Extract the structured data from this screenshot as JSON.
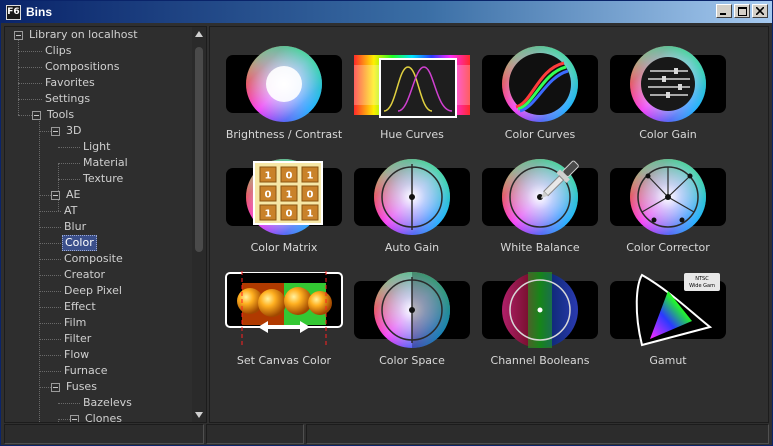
{
  "window": {
    "title": "Bins",
    "app_badge": "F6"
  },
  "tree": {
    "items": [
      {
        "label": "Library on localhost",
        "level": 0,
        "expander": true
      },
      {
        "label": "Clips",
        "level": 1
      },
      {
        "label": "Compositions",
        "level": 1
      },
      {
        "label": "Favorites",
        "level": 1
      },
      {
        "label": "Settings",
        "level": 1
      },
      {
        "label": "Tools",
        "level": 1,
        "expander": true
      },
      {
        "label": "3D",
        "level": 2,
        "expander": true
      },
      {
        "label": "Light",
        "level": 3
      },
      {
        "label": "Material",
        "level": 3
      },
      {
        "label": "Texture",
        "level": 3
      },
      {
        "label": "AE",
        "level": 2,
        "expander": true
      },
      {
        "label": "AT",
        "level": 2
      },
      {
        "label": "Blur",
        "level": 2
      },
      {
        "label": "Color",
        "level": 2,
        "selected": true
      },
      {
        "label": "Composite",
        "level": 2
      },
      {
        "label": "Creator",
        "level": 2
      },
      {
        "label": "Deep Pixel",
        "level": 2
      },
      {
        "label": "Effect",
        "level": 2
      },
      {
        "label": "Film",
        "level": 2
      },
      {
        "label": "Filter",
        "level": 2
      },
      {
        "label": "Flow",
        "level": 2
      },
      {
        "label": "Furnace",
        "level": 2
      },
      {
        "label": "Fuses",
        "level": 2,
        "expander": true
      },
      {
        "label": "Bazelevs",
        "level": 3
      },
      {
        "label": "Clones",
        "level": 3,
        "expander": true
      }
    ]
  },
  "tools": [
    {
      "label": "Brightness / Contrast",
      "icon": "brightness-contrast-icon"
    },
    {
      "label": "Hue Curves",
      "icon": "hue-curves-icon"
    },
    {
      "label": "Color Curves",
      "icon": "color-curves-icon"
    },
    {
      "label": "Color Gain",
      "icon": "color-gain-icon"
    },
    {
      "label": "Color Matrix",
      "icon": "color-matrix-icon",
      "matrix": [
        "1",
        "0",
        "1",
        "0",
        "1",
        "0",
        "1",
        "0",
        "1"
      ]
    },
    {
      "label": "Auto Gain",
      "icon": "auto-gain-icon"
    },
    {
      "label": "White Balance",
      "icon": "white-balance-icon"
    },
    {
      "label": "Color Corrector",
      "icon": "color-corrector-icon"
    },
    {
      "label": "Set Canvas Color",
      "icon": "set-canvas-color-icon"
    },
    {
      "label": "Color Space",
      "icon": "color-space-icon"
    },
    {
      "label": "Channel Booleans",
      "icon": "channel-booleans-icon"
    },
    {
      "label": "Gamut",
      "icon": "gamut-icon",
      "badge_line1": "NTSC",
      "badge_line2": "Wide Gam"
    }
  ],
  "colors": {
    "title_start": "#0a246a",
    "title_end": "#a6caf0",
    "panel_bg": "#2f2f2f",
    "selection": "#3b4f8a"
  }
}
